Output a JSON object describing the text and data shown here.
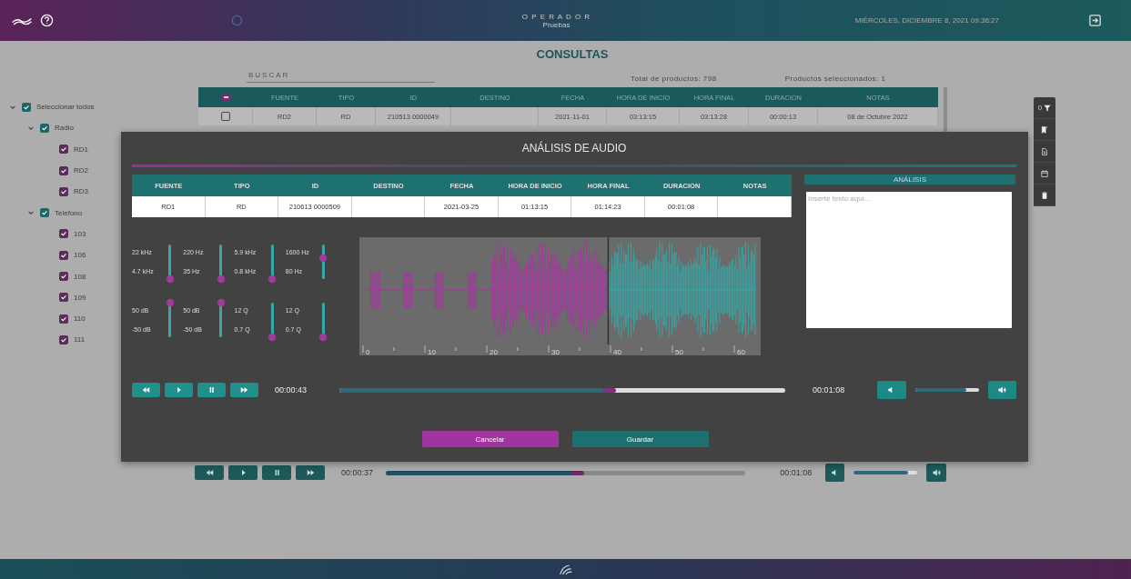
{
  "header": {
    "app_title": "O P E R A D O R",
    "subtitle": "Pruebas",
    "datetime": "MIÉRCOLES, DICIEMBRE 8, 2021 09:36:27"
  },
  "page_title": "CONSULTAS",
  "search": {
    "placeholder": "BUSCAR"
  },
  "total_products": "Total de productos: 798",
  "selected_products": "Productos seleccionados: 1",
  "tree": [
    {
      "label": "Seleccionar todos",
      "checked": true,
      "expanded": true,
      "children": [
        {
          "label": "Radio",
          "checked": true,
          "expanded": true,
          "children": [
            {
              "label": "RD1",
              "checked": true
            },
            {
              "label": "RD2",
              "checked": true
            },
            {
              "label": "RD3",
              "checked": true
            }
          ]
        },
        {
          "label": "Telefono",
          "checked": true,
          "expanded": true,
          "children": [
            {
              "label": "103",
              "checked": true
            },
            {
              "label": "106",
              "checked": true
            },
            {
              "label": "108",
              "checked": true
            },
            {
              "label": "109",
              "checked": true
            },
            {
              "label": "110",
              "checked": true
            },
            {
              "label": "111",
              "checked": true
            }
          ]
        }
      ]
    }
  ],
  "table": {
    "header_checkbox": {
      "indeterminate": true
    },
    "columns": [
      "FUENTE",
      "TIPO",
      "ID",
      "DESTINO",
      "FECHA",
      "HORA DE INICIO",
      "HORA FINAL",
      "DURACION",
      "NOTAS"
    ],
    "rows": [
      {
        "selected": false,
        "fuente": "RD2",
        "tipo": "RD",
        "id": "210513 0000049",
        "fecha": "2021-11-01",
        "hora_de_inicio": "03:13:15",
        "hora_final": "03:13:28",
        "duracion": "00:00:13",
        "notas": "08 de Octubre 2022"
      }
    ]
  },
  "toolbar": {
    "filter_count": "0"
  },
  "background_player": {
    "elapsed": "00:00:37",
    "level": 0.55,
    "total": "00:01:08",
    "volume": {
      "level": 0.85
    }
  },
  "dialog": {
    "title": "ANÁLISIS DE AUDIO",
    "columns": [
      "FUENTE",
      "TIPO",
      "ID",
      "DESTINO",
      "FECHA",
      "HORA DE INICIO",
      "HORA FINAL",
      "DURACION",
      "NOTAS"
    ],
    "row": {
      "fuente": "RD1",
      "tipo": "RD",
      "id": "210613 0000509",
      "fecha": "2021-03-25",
      "hora_de_inicio": "01:13:15",
      "hora_final": "01:14:23",
      "duracion": "00:01:08"
    },
    "analysis": {
      "title": "ANÁLISIS",
      "placeholder": "Inserte texto aquí..."
    },
    "filters": [
      {
        "top": "22 kHz",
        "bottom": "4.7 kHz",
        "level": 0
      },
      {
        "top": "220 Hz",
        "bottom": "35 Hz",
        "level": 0
      },
      {
        "top": "5.9 kHz",
        "bottom": "0.8 kHz",
        "level": 0
      },
      {
        "top": "1600 Hz",
        "bottom": "80 Hz",
        "level": 0.6
      },
      {
        "top": "50 dB",
        "bottom": "-50 dB",
        "level": 1
      },
      {
        "top": "50 dB",
        "bottom": "-50 dB",
        "level": 1
      },
      {
        "top": "12 Q",
        "bottom": "0.7 Q",
        "level": 0
      },
      {
        "top": "12 Q",
        "bottom": "0.7 Q",
        "level": 0
      }
    ],
    "waveform": {
      "level": 0.62,
      "ticks": [
        "0",
        "10",
        "20",
        "30",
        "40",
        "50",
        "60"
      ]
    },
    "player": {
      "elapsed": "00:00:43",
      "level": 0.62,
      "total": "00:01:08"
    },
    "buttons": [
      {
        "label": "Cancelar",
        "kind": "cancel"
      },
      {
        "label": "Guardar",
        "kind": "save"
      }
    ]
  }
}
